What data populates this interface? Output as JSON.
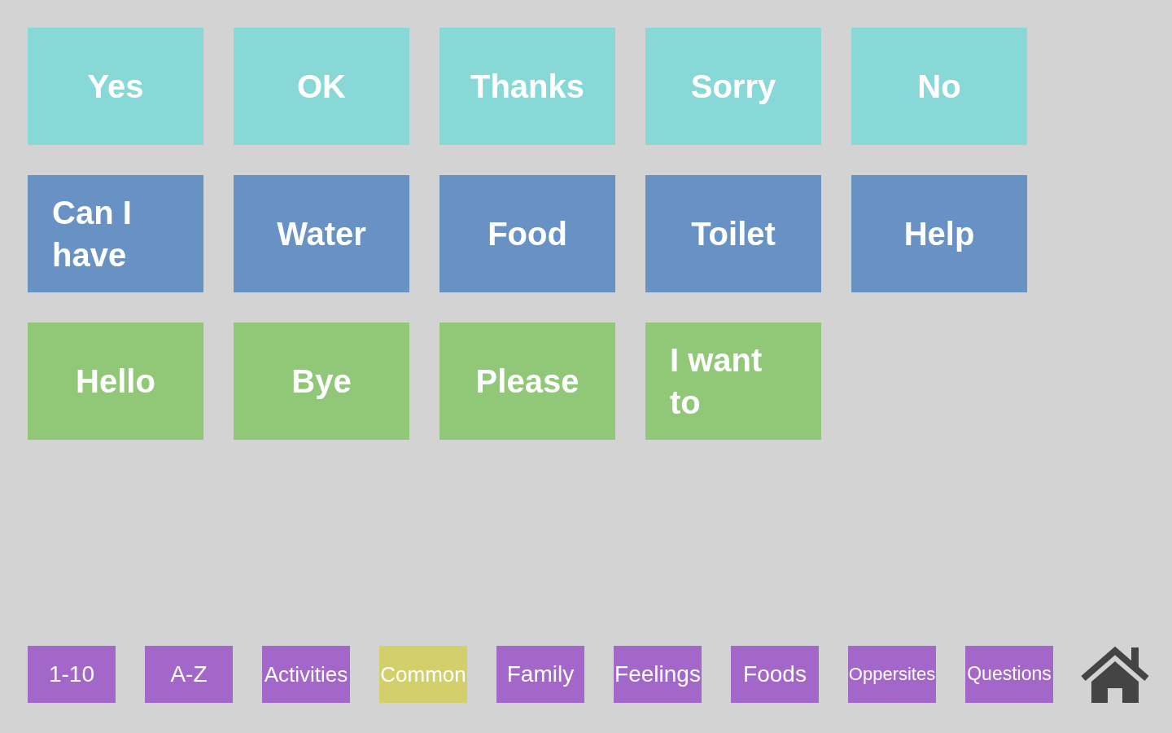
{
  "grid_rows": [
    {
      "color": "#88d8d8",
      "words": [
        "Yes",
        "OK",
        "Thanks",
        "Sorry",
        "No"
      ]
    },
    {
      "color": "#6892c4",
      "words": [
        "Can I have",
        "Water",
        "Food",
        "Toilet",
        "Help"
      ]
    },
    {
      "color": "#90c878",
      "words": [
        "Hello",
        "Bye",
        "Please",
        "I want to"
      ]
    }
  ],
  "categories": [
    {
      "label": "1-10",
      "selected": false
    },
    {
      "label": "A-Z",
      "selected": false
    },
    {
      "label": "Activities",
      "selected": false
    },
    {
      "label": "Common",
      "selected": true
    },
    {
      "label": "Family",
      "selected": false
    },
    {
      "label": "Feelings",
      "selected": false
    },
    {
      "label": "Foods",
      "selected": false
    },
    {
      "label": "Oppersites",
      "selected": false
    },
    {
      "label": "Questions",
      "selected": false
    }
  ]
}
